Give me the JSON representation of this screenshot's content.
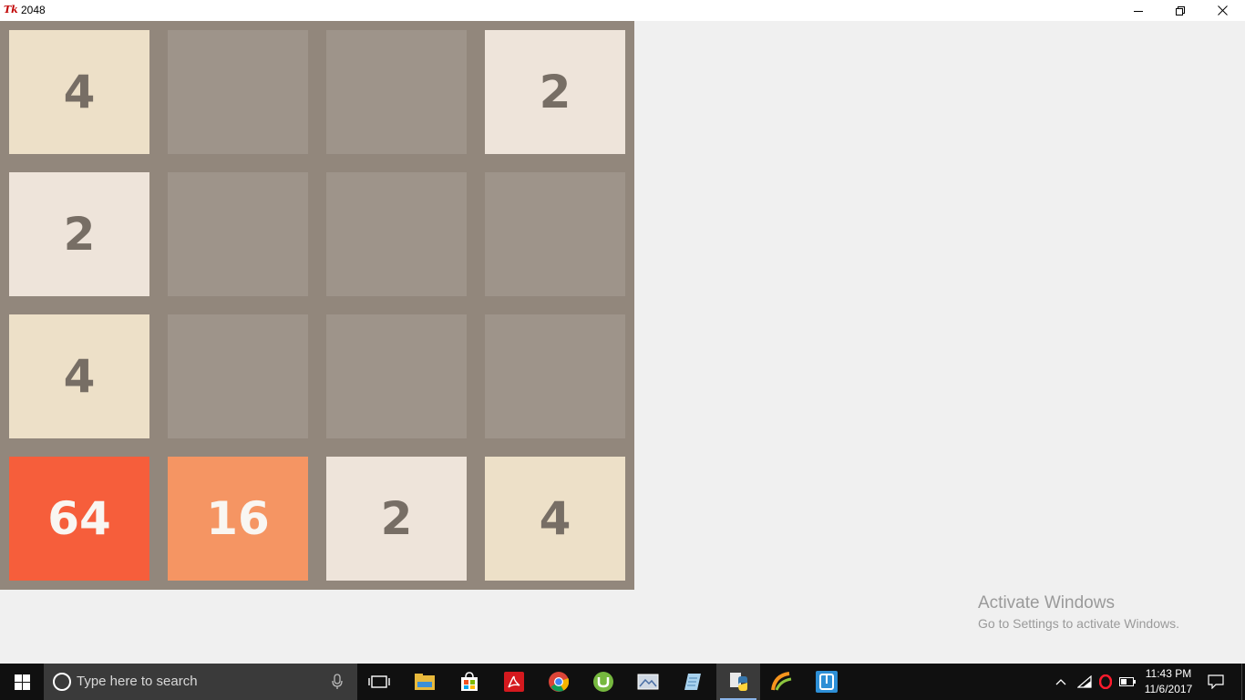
{
  "window": {
    "app_icon_text": "Tk",
    "title": "2048",
    "controls": [
      "minimize",
      "maximize",
      "close"
    ]
  },
  "board": {
    "rows": 4,
    "cols": 4,
    "tiles": [
      [
        4,
        null,
        null,
        2
      ],
      [
        2,
        null,
        null,
        null
      ],
      [
        4,
        null,
        null,
        null
      ],
      [
        64,
        16,
        2,
        4
      ]
    ],
    "colors": {
      "board_bg": "#92877c",
      "empty": "#9e948a",
      "2": {
        "bg": "#eee4da",
        "fg": "#776e65"
      },
      "4": {
        "bg": "#ede0c8",
        "fg": "#776e65"
      },
      "16": {
        "bg": "#f59563",
        "fg": "#f9f6f2"
      },
      "64": {
        "bg": "#f65e3b",
        "fg": "#f9f6f2"
      }
    }
  },
  "watermark": {
    "line1": "Activate Windows",
    "line2": "Go to Settings to activate Windows."
  },
  "taskbar": {
    "search_placeholder": "Type here to search",
    "apps": [
      {
        "name": "task-view-icon"
      },
      {
        "name": "file-explorer-icon"
      },
      {
        "name": "store-icon"
      },
      {
        "name": "acrobat-icon"
      },
      {
        "name": "chrome-icon"
      },
      {
        "name": "utorrent-icon"
      },
      {
        "name": "image-viewer-icon"
      },
      {
        "name": "notepad-icon"
      },
      {
        "name": "python-icon"
      },
      {
        "name": "app-icon-orange"
      },
      {
        "name": "app-icon-blue"
      }
    ],
    "clock": {
      "time": "11:43 PM",
      "date": "11/6/2017"
    }
  }
}
